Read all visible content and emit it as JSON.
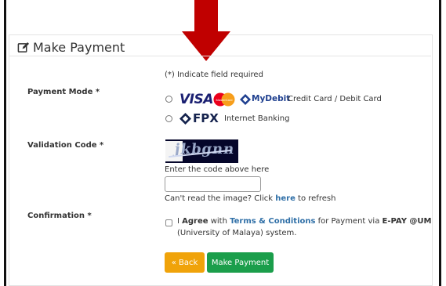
{
  "panel": {
    "title": "Make Payment"
  },
  "form": {
    "required_note": "(*) Indicate field required",
    "payment_mode_label": "Payment Mode *",
    "visa_text": "VISA",
    "mastercard_text": "MasterCard",
    "mydebit_text": "MyDebit",
    "card_option_text": "Credit Card / Debit Card",
    "fpx_text": "FPX",
    "fpx_option_text": "Internet Banking",
    "validation_label": "Validation Code *",
    "captcha_text": "jkbgnn",
    "enter_code_hint": "Enter the code above here",
    "refresh_prefix": "Can't read the image? Click ",
    "refresh_link": "here",
    "refresh_suffix": " to refresh",
    "confirmation_label": "Confirmation *",
    "agree_prefix": "I ",
    "agree_bold": "Agree",
    "agree_with": " with ",
    "terms_link": "Terms & Conditions",
    "agree_for": " for Payment via ",
    "epay_bold": "E-PAY @UM",
    "agree_line2": "(University of Malaya) system.",
    "back_label": "« Back",
    "pay_label": "Make Payment"
  },
  "colors": {
    "arrow": "#c00000",
    "back_button": "#f0a30a",
    "pay_button": "#1b9e4b",
    "link": "#2f6fa7",
    "visa": "#1a1f71",
    "fpx": "#14224d"
  },
  "icons": {
    "edit": "edit-icon",
    "arrow": "down-arrow-icon"
  }
}
